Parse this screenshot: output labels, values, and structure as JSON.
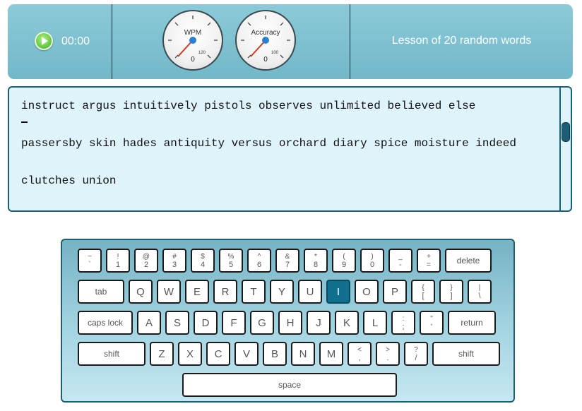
{
  "toolbar": {
    "play_icon": "play-circle-icon",
    "timer": "00:00",
    "lesson_title": "Lesson of 20 random words"
  },
  "gauges": [
    {
      "label": "WPM",
      "value": "0",
      "max_tick": "120"
    },
    {
      "label": "Accuracy",
      "value": "0",
      "max_tick": "100"
    }
  ],
  "text_panel": {
    "lines": [
      "instruct argus intuitively pistols observes unlimited believed else",
      "passersby skin hades antiquity versus orchard diary spice moisture indeed",
      "clutches union"
    ]
  },
  "keyboard": {
    "active_key": "I",
    "row1": [
      {
        "top": "~",
        "bottom": "`"
      },
      {
        "top": "!",
        "bottom": "1"
      },
      {
        "top": "@",
        "bottom": "2"
      },
      {
        "top": "#",
        "bottom": "3"
      },
      {
        "top": "$",
        "bottom": "4"
      },
      {
        "top": "%",
        "bottom": "5"
      },
      {
        "top": "^",
        "bottom": "6"
      },
      {
        "top": "&",
        "bottom": "7"
      },
      {
        "top": "*",
        "bottom": "8"
      },
      {
        "top": "(",
        "bottom": "9"
      },
      {
        "top": ")",
        "bottom": "0"
      },
      {
        "top": "_",
        "bottom": "-"
      },
      {
        "top": "+",
        "bottom": "="
      }
    ],
    "delete_label": "delete",
    "tab_label": "tab",
    "row2": [
      "Q",
      "W",
      "E",
      "R",
      "T",
      "Y",
      "U",
      "I",
      "O",
      "P"
    ],
    "row2_symbols": [
      {
        "top": "{",
        "bottom": "["
      },
      {
        "top": "}",
        "bottom": "]"
      },
      {
        "top": "|",
        "bottom": "\\"
      }
    ],
    "caps_label": "caps lock",
    "row3": [
      "A",
      "S",
      "D",
      "F",
      "G",
      "H",
      "J",
      "K",
      "L"
    ],
    "row3_symbols": [
      {
        "top": ":",
        "bottom": ";"
      },
      {
        "top": "\"",
        "bottom": "'"
      }
    ],
    "return_label": "return",
    "shift_label": "shift",
    "row4": [
      "Z",
      "X",
      "C",
      "V",
      "B",
      "N",
      "M"
    ],
    "row4_symbols": [
      {
        "top": "<",
        "bottom": ","
      },
      {
        "top": ">",
        "bottom": "."
      },
      {
        "top": "?",
        "bottom": "/"
      }
    ],
    "space_label": "space"
  }
}
